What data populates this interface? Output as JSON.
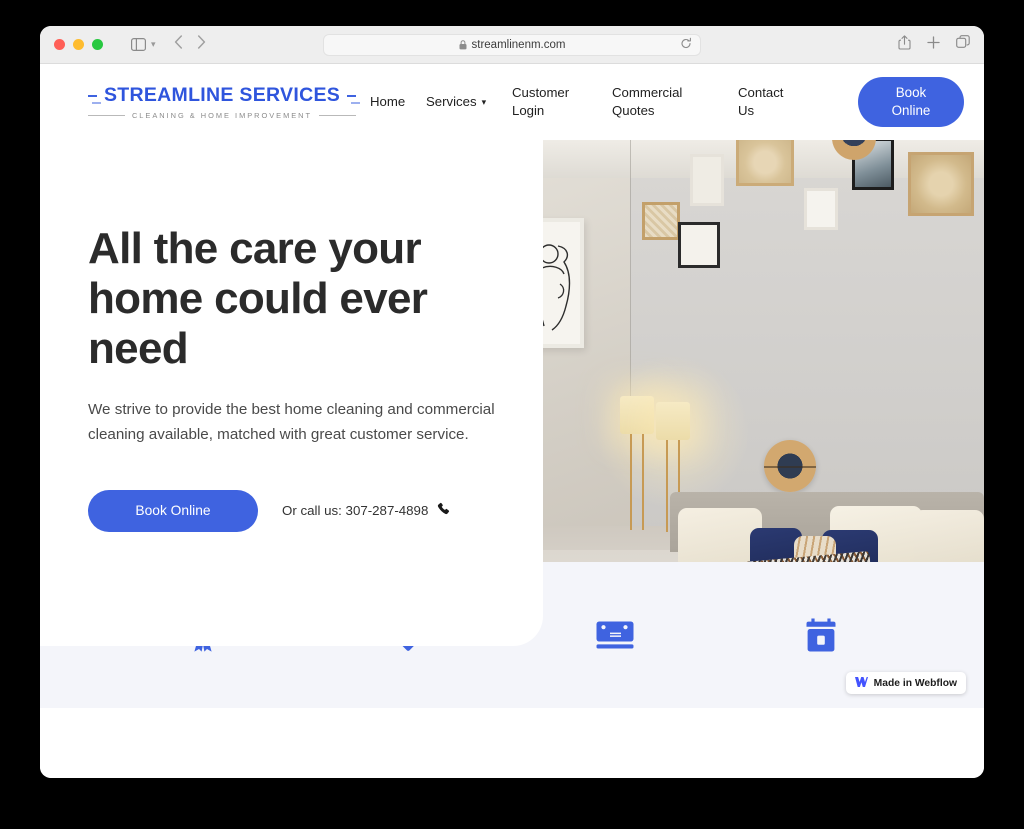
{
  "browser": {
    "url": "streamlinenm.com",
    "traffic_lights": [
      "close",
      "minimize",
      "maximize"
    ],
    "toolbar_icons": [
      "sidebar-icon",
      "chevron-down-icon",
      "back-icon",
      "forward-icon",
      "lock-icon",
      "reload-icon",
      "share-icon",
      "new-tab-icon",
      "tab-overview-icon"
    ]
  },
  "site": {
    "logo": {
      "name": "STREAMLINE SERVICES",
      "tagline": "CLEANING & HOME IMPROVEMENT"
    },
    "nav": [
      {
        "label": "Home",
        "has_chevron": false
      },
      {
        "label": "Services",
        "has_chevron": true
      },
      {
        "label": "Customer\nLogin",
        "has_chevron": false
      },
      {
        "label": "Commercial\nQuotes",
        "has_chevron": false
      },
      {
        "label": "Contact\nUs",
        "has_chevron": false
      }
    ],
    "header_cta": "Book\nOnline",
    "hero": {
      "headline": "All the care your home could ever need",
      "subtext": "We strive to provide the best home cleaning and commercial cleaning available, matched with great customer service.",
      "cta_label": "Book Online",
      "phone_text": "Or call us: 307-287-4898",
      "phone_icon": "phone-icon",
      "image_alt": "Modern bedroom with gallery wall, navy and cream pillows, and wooden bench"
    },
    "features": [
      {
        "icon": "award-ribbon-icon"
      },
      {
        "icon": "price-tag-icon"
      },
      {
        "icon": "credit-card-icon"
      },
      {
        "icon": "calendar-icon"
      }
    ],
    "badge": {
      "text": "Made in Webflow",
      "icon": "webflow-logo-icon"
    },
    "colors": {
      "brand_blue": "#3F63E0",
      "logo_blue": "#2F55DD",
      "band_bg": "#F4F5FA",
      "heading": "#2B2B2B"
    }
  }
}
